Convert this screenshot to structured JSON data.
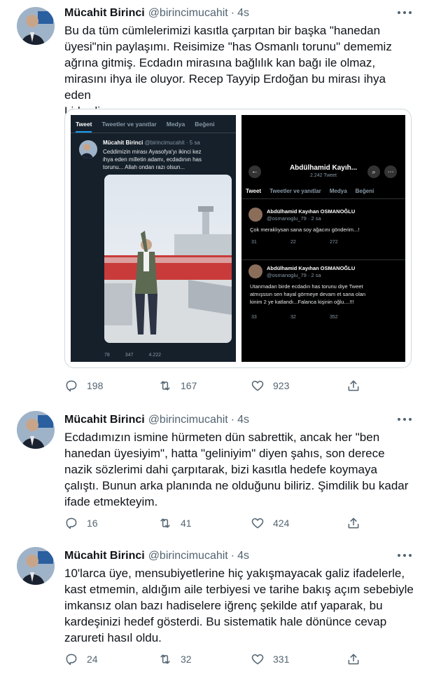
{
  "tweets": [
    {
      "name": "Mücahit Birinci",
      "handle": "@birincimucahit",
      "dot": "·",
      "time": "4s",
      "lines": [
        "Bu da tüm cümlelerimizi kasıtla çarpıtan bir başka \"hanedan",
        "üyesi\"nin paylaşımı. Reisimize \"has Osmanlı torunu\" dememiz",
        "ağrına gitmiş. Ecdadın mirasına bağlılık kan bağı ile olmaz,",
        "mirasını ihya ile oluyor. Recep Tayyip Erdoğan bu mirası ihya eden",
        "Liderdir."
      ],
      "replies": "198",
      "retweets": "167",
      "likes": "923"
    },
    {
      "name": "Mücahit Birinci",
      "handle": "@birincimucahit",
      "dot": "·",
      "time": "4s",
      "lines": [
        "Ecdadımızın ismine hürmeten dün sabrettik, ancak her \"ben",
        "hanedan üyesiyim\", hatta \"geliniyim\" diyen şahıs, son derece",
        "nazik sözlerimi dahi çarpıtarak, bizi kasıtla hedefe koymaya",
        "çalıştı. Bunun arka planında ne olduğunu biliriz. Şimdilik bu kadar",
        "ifade etmekteyim."
      ],
      "replies": "16",
      "retweets": "41",
      "likes": "424"
    },
    {
      "name": "Mücahit Birinci",
      "handle": "@birincimucahit",
      "dot": "·",
      "time": "4s",
      "lines": [
        "10'larca üye, mensubiyetlerine hiç yakışmayacak galiz ifadelerle,",
        "kast etmemin, aldığım aile terbiyesi ve tarihe bakış açım sebebiyle",
        "imkansız olan bazı hadiselere iğrenç şekilde atıf yaparak, bu",
        "kardeşinizi hedef gösterdi. Bu sistematik hale dönünce cevap",
        "zarureti hasıl oldu."
      ],
      "replies": "24",
      "retweets": "32",
      "likes": "331"
    }
  ],
  "media": {
    "left": {
      "tabs": [
        "Tweet",
        "Tweetler ve yanıtlar",
        "Medya",
        "Beğeni"
      ],
      "name": "Mücahit Birinci",
      "handle": "@birincimucahit · 5 sa",
      "lines": [
        "Ceddimizin mirası Ayasofya'yı ikinci kez",
        "ihya eden milletin adamı, ecdadının has",
        "torunu... Allah ondan razı olsun..."
      ],
      "replies": "78",
      "retweets": "347",
      "likes": "4.222"
    },
    "right": {
      "title": "Abdülhamid Kayıh...",
      "subtitle": "2.242 Tweet",
      "tabs": [
        "Tweet",
        "Tweetler ve yanıtlar",
        "Medya",
        "Beğeni"
      ],
      "posts": [
        {
          "name": "Abdülhamid Kayıhan OSMANOĞLU",
          "handle": "@osmanoglu_79 · 2 sa",
          "lines": [
            "Çok meraklıysan sana soy ağacını gönderim...!"
          ],
          "replies": "31",
          "retweets": "22",
          "likes": "272"
        },
        {
          "name": "Abdülhamid Kayıhan OSMANOĞLU",
          "handle": "@osmanoglu_79 · 2 sa",
          "lines": [
            "Utanmadan birde ecdadın has torunu diye Tweet",
            "atmışssın sen hayal görmeye devam et sana olan",
            "kinim 2 ye katlandı...Falanca kişinin oğlu....!!!"
          ],
          "replies": "33",
          "retweets": "32",
          "likes": "352"
        }
      ]
    }
  }
}
